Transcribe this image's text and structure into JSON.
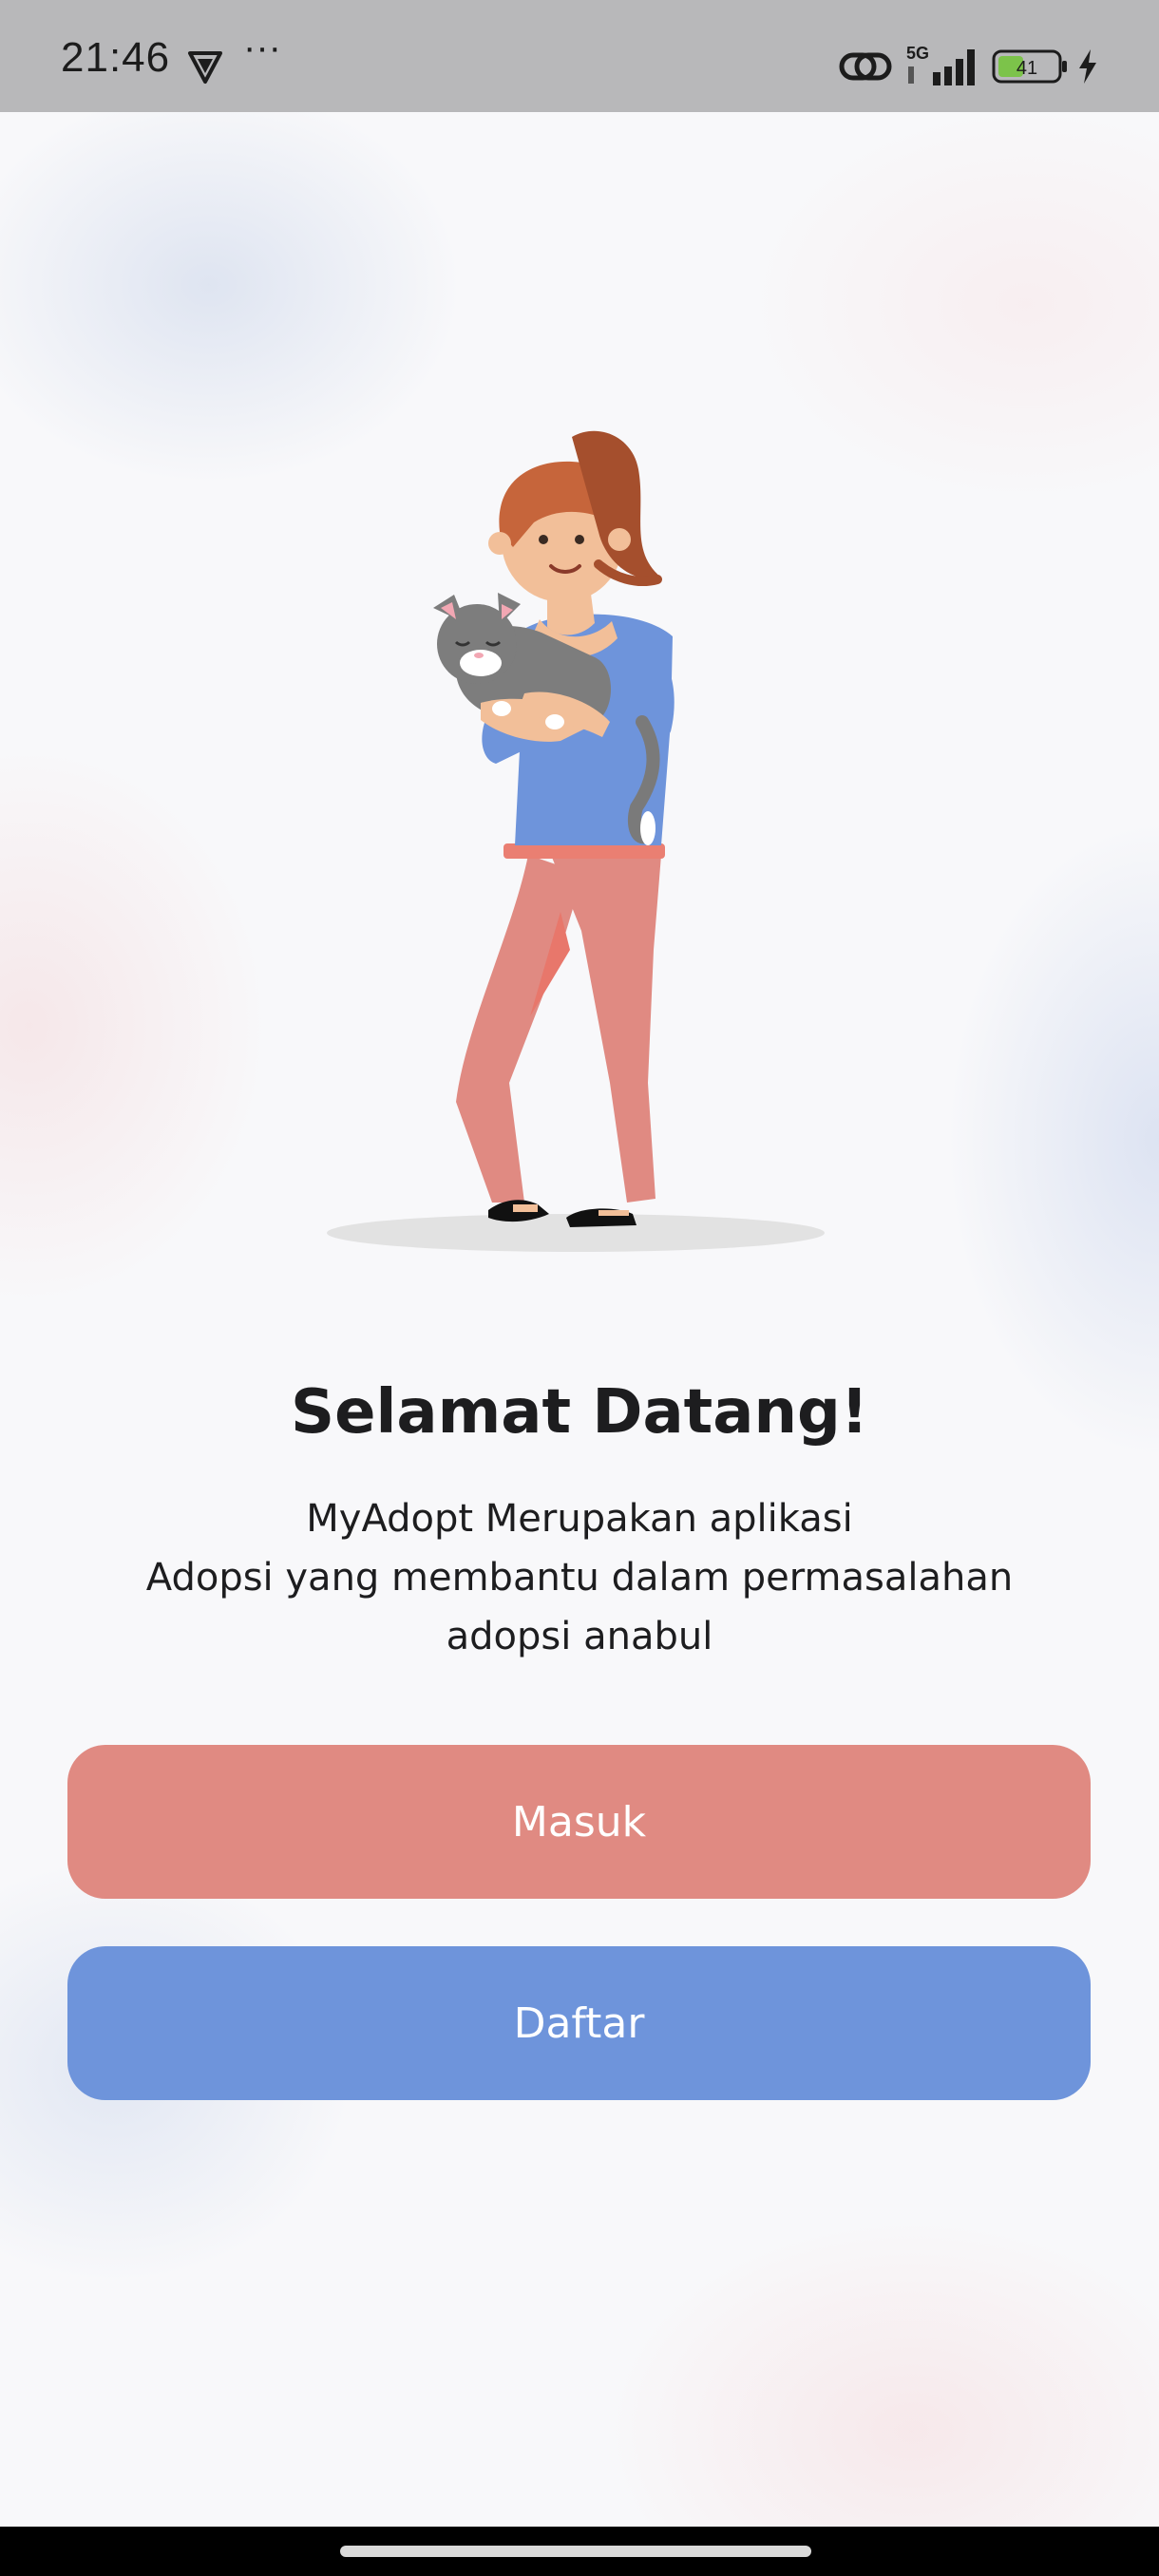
{
  "status_bar": {
    "time": "21:46",
    "more": "···",
    "network": "5G",
    "battery_level": "41"
  },
  "icons": {
    "vpn": "vpn-shield-icon",
    "link": "link-icon",
    "signal": "signal-icon",
    "battery": "battery-icon",
    "charging": "charging-icon"
  },
  "welcome": {
    "title": "Selamat Datang!",
    "description": "MyAdopt  Merupakan aplikasi\nAdopsi yang membantu dalam permasalahan\nadopsi anabul"
  },
  "buttons": {
    "login_label": "Masuk",
    "register_label": "Daftar"
  },
  "colors": {
    "login_button": "#e08a82",
    "register_button": "#6e94db",
    "status_bar": "#b8b8ba"
  }
}
